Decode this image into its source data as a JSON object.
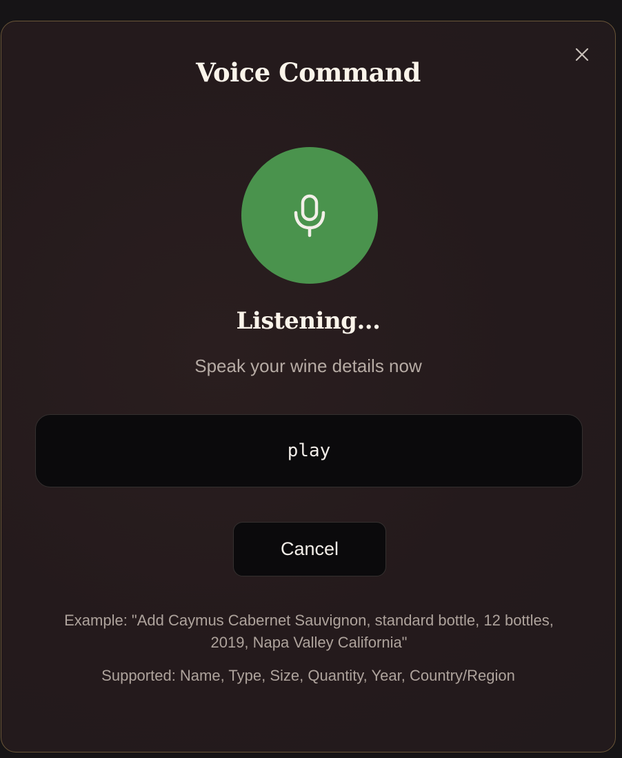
{
  "modal": {
    "title": "Voice Command",
    "close_icon": "close-icon",
    "mic_icon": "microphone-icon",
    "status": "Listening...",
    "subtitle": "Speak your wine details now",
    "transcript": "play",
    "cancel_label": "Cancel",
    "example_text": "Example: \"Add Caymus Cabernet Sauvignon, standard bottle, 12 bottles, 2019, Napa Valley California\"",
    "supported_text": "Supported: Name, Type, Size, Quantity, Year, Country/Region"
  },
  "colors": {
    "accent_green": "#4a934d",
    "modal_border": "#6a5638",
    "title_text": "#fbf4ea"
  }
}
